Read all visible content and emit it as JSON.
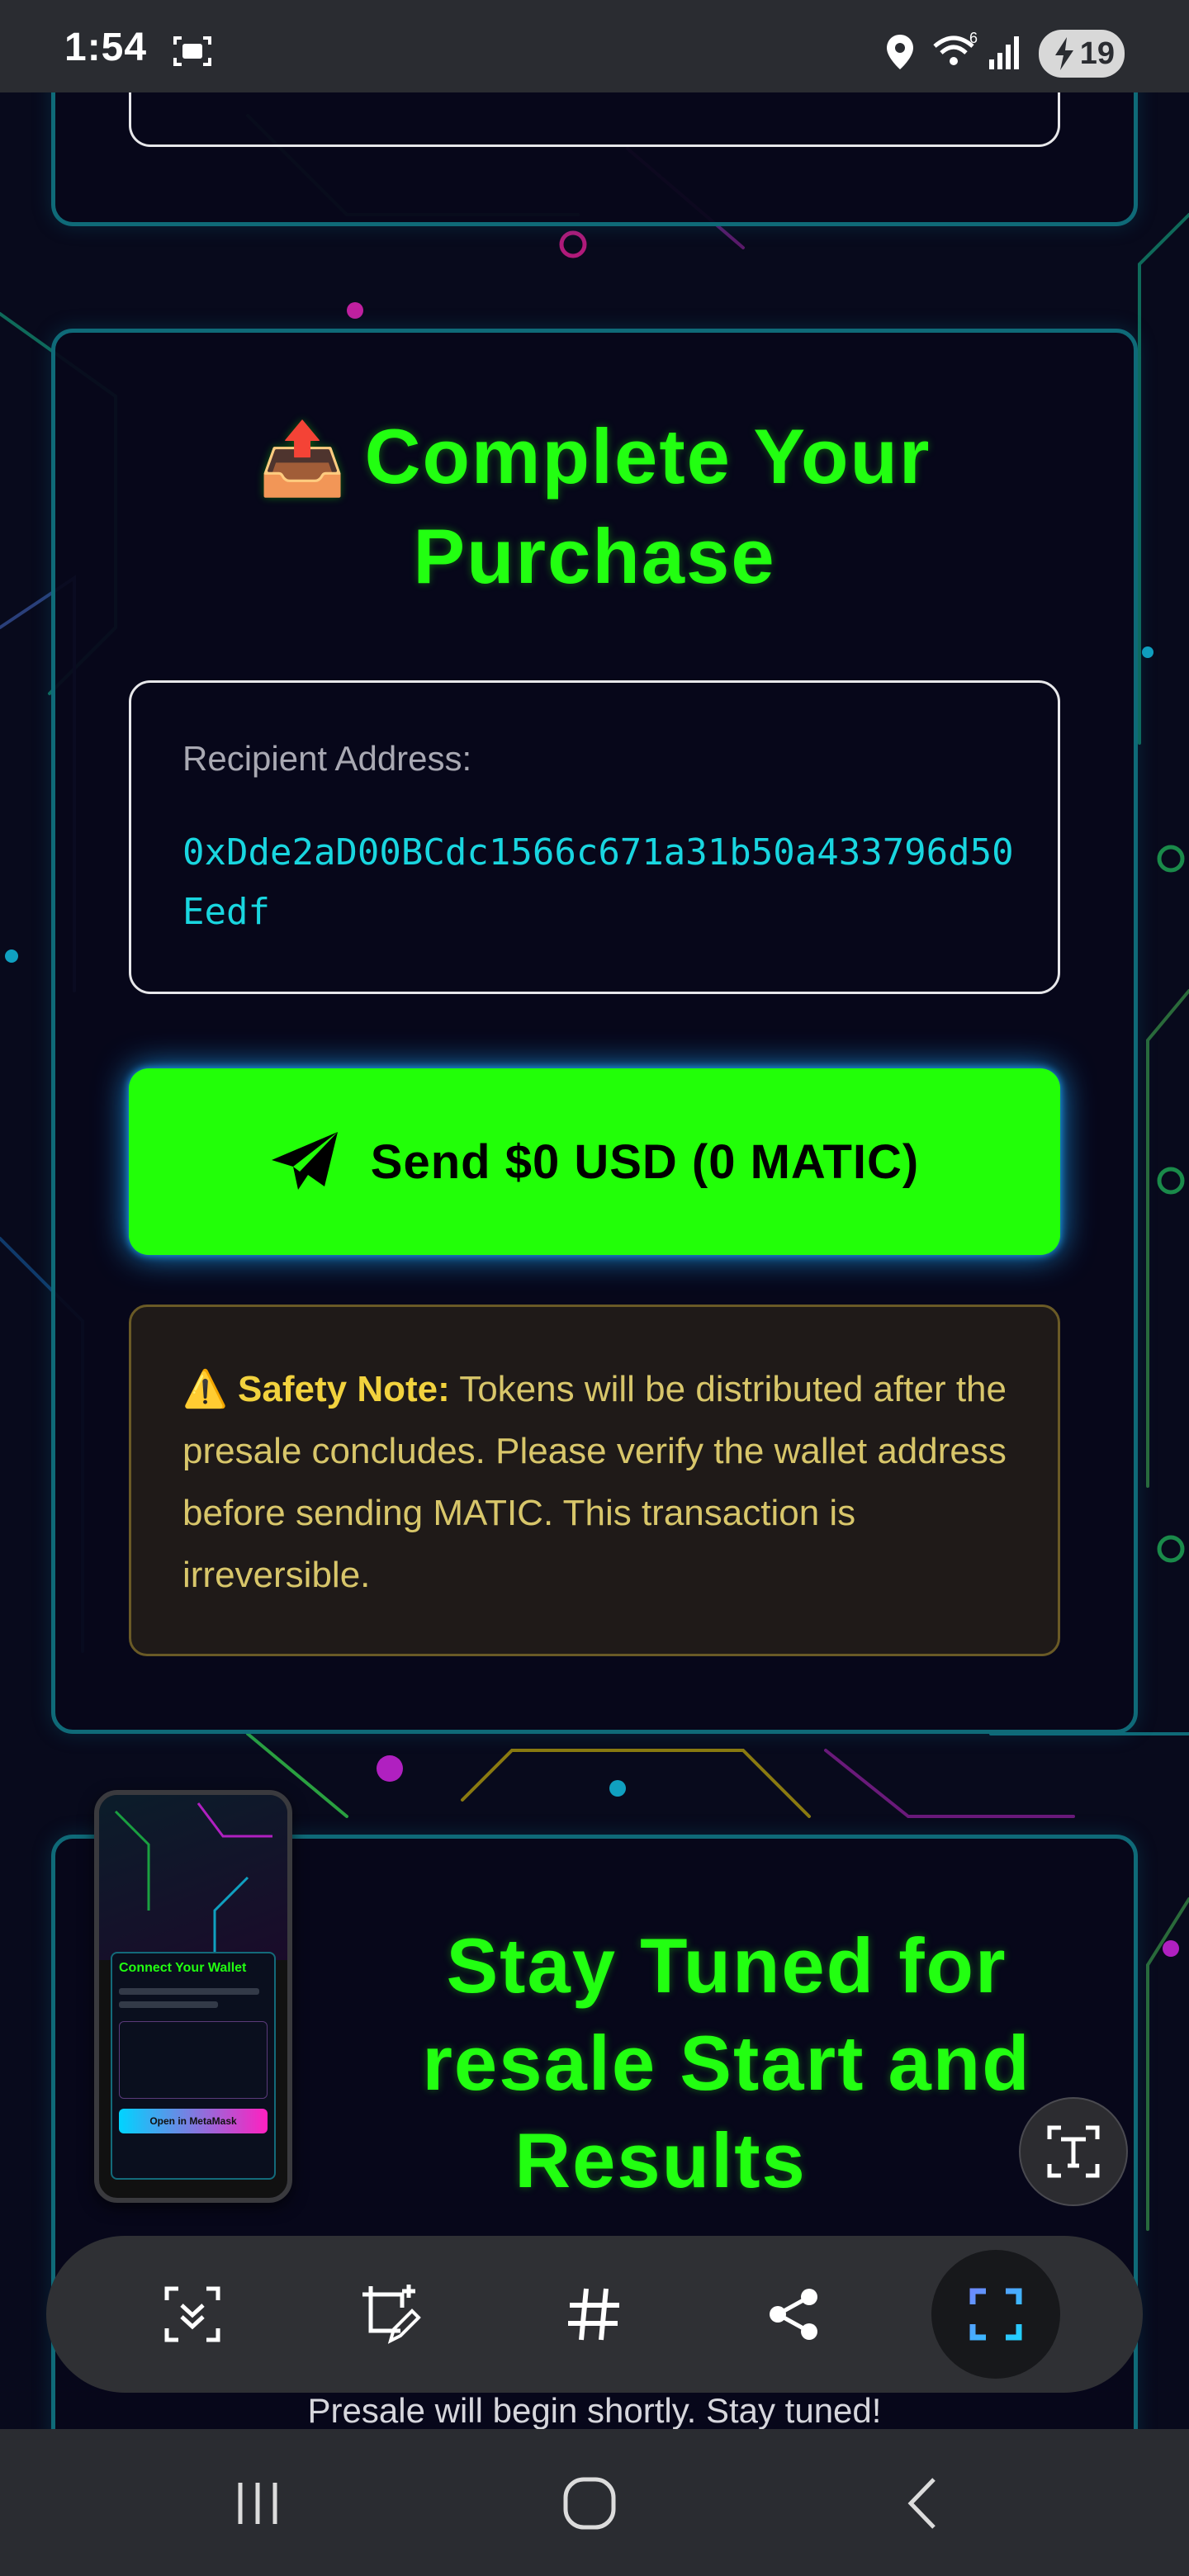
{
  "status_bar": {
    "time": "1:54",
    "battery": "19",
    "icons": [
      "screen-record-icon",
      "location-icon",
      "wifi-icon",
      "signal-icon",
      "battery-charging-icon"
    ]
  },
  "purchase": {
    "title_emoji": "📤",
    "title_line1": "Complete Your",
    "title_line2": "Purchase",
    "recipient_label": "Recipient Address:",
    "recipient_address": "0xDde2aD00BCdc1566c671a31b50a433796d50Eedf",
    "send_button_label": "Send $0 USD (0 MATIC)",
    "safety_title": "Safety Note:",
    "safety_text": "Tokens will be distributed after the presale concludes. Please verify the wallet address before sending MATIC. This transaction is irreversible."
  },
  "stay_tuned": {
    "title_line1": "Stay Tuned for",
    "title_line2": "resale Start and",
    "title_line3": "Results",
    "subtext": "Presale will begin shortly. Stay tuned!"
  },
  "thumbnail": {
    "header": "Connect Your Wallet",
    "button": "Open in MetaMask"
  },
  "toolbar": {
    "items": [
      "smart-select-icon",
      "draw-crop-icon",
      "hashtag-icon",
      "share-icon",
      "capture-icon"
    ]
  },
  "colors": {
    "neon_green": "#22ff11",
    "cyan": "#19d6e0",
    "warning_gold": "#d8c66a",
    "card_border": "#0f6a78"
  }
}
